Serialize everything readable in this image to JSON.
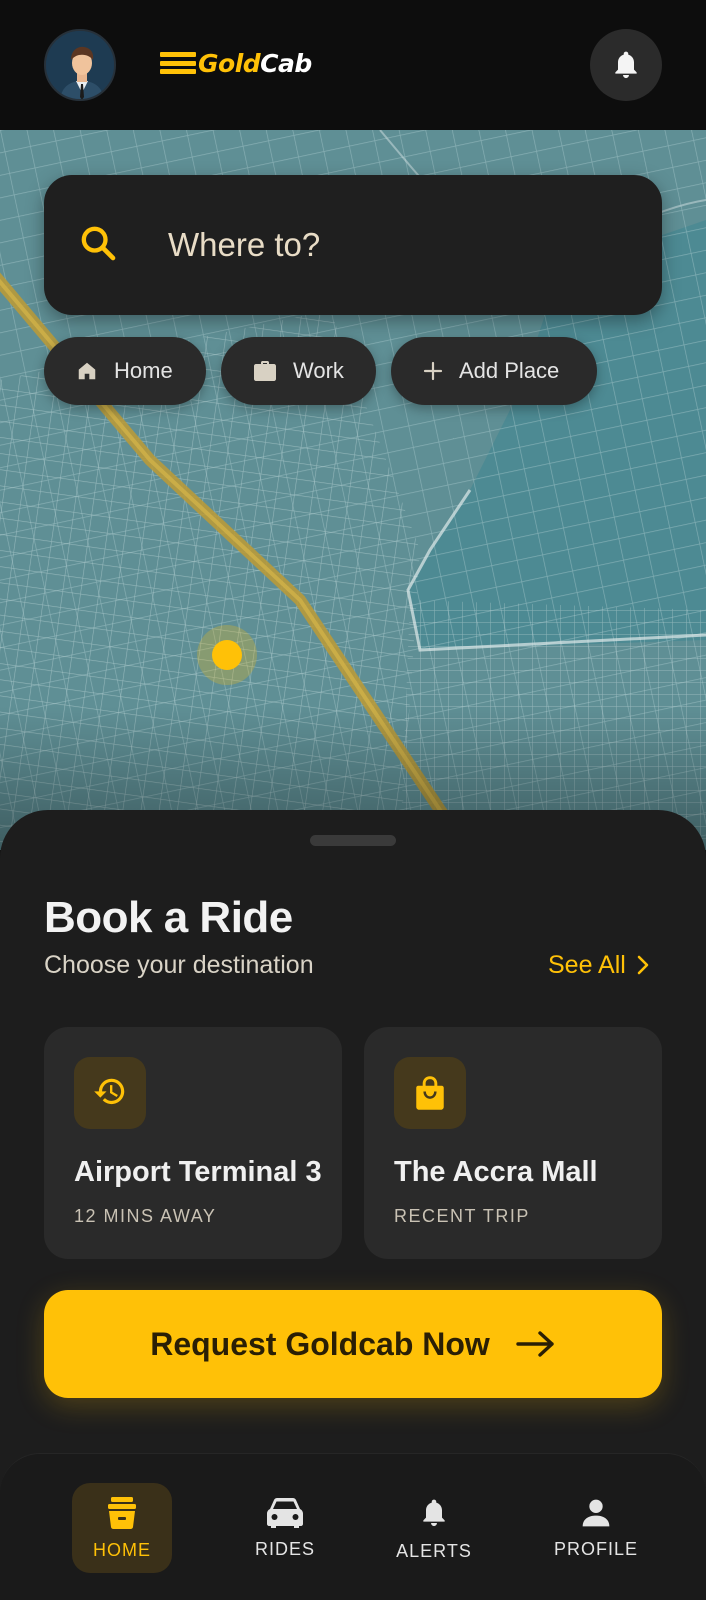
{
  "header": {
    "avatar_icon": "user-avatar",
    "logo": {
      "part1": "Gold",
      "part2": "Cab"
    },
    "notifications_icon": "bell-icon"
  },
  "search": {
    "placeholder": "Where to?",
    "icon": "search-icon"
  },
  "quick_places": [
    {
      "label": "Home",
      "icon": "home-icon"
    },
    {
      "label": "Work",
      "icon": "briefcase-icon"
    },
    {
      "label": "Add Place",
      "icon": "plus-icon"
    }
  ],
  "sheet": {
    "title": "Book a Ride",
    "subtitle": "Choose your destination",
    "see_all": "See All"
  },
  "destinations": [
    {
      "title": "Airport Terminal 3",
      "subtitle": "12 MINS AWAY",
      "icon": "history-icon"
    },
    {
      "title": "The Accra Mall",
      "subtitle": "RECENT TRIP",
      "icon": "shopping-bag-icon"
    }
  ],
  "cta": {
    "label": "Request Goldcab Now",
    "icon": "arrow-right-icon"
  },
  "nav": [
    {
      "label": "HOME",
      "icon": "home-icon",
      "active": true
    },
    {
      "label": "RIDES",
      "icon": "car-icon",
      "active": false
    },
    {
      "label": "ALERTS",
      "icon": "bell-icon",
      "active": false
    },
    {
      "label": "PROFILE",
      "icon": "person-icon",
      "active": false
    }
  ],
  "colors": {
    "accent": "#ffc107",
    "background": "#0d0d0d",
    "surface": "#1d1d1d",
    "card": "#2a2a2a",
    "map_water": "#3e7f8a"
  }
}
